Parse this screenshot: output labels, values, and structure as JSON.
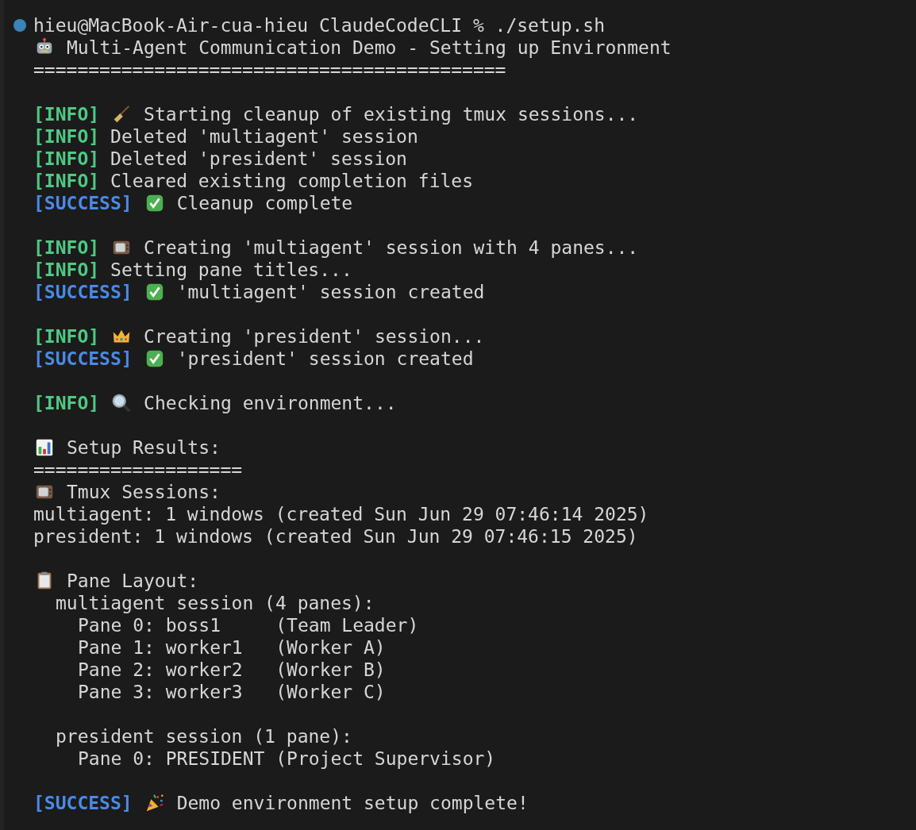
{
  "terminal": {
    "lines": [
      {
        "kind": "prompt",
        "text": "hieu@MacBook-Air-cua-hieu ClaudeCodeCLI % ./setup.sh"
      },
      {
        "kind": "heading",
        "text": "Multi-Agent Communication Demo - Setting up Environment"
      },
      {
        "kind": "text",
        "text": "==========================================="
      },
      {
        "kind": "blank"
      },
      {
        "kind": "info",
        "tag": "[INFO]",
        "text": "Starting cleanup of existing tmux sessions..."
      },
      {
        "kind": "info",
        "tag": "[INFO]",
        "text": "Deleted 'multiagent' session"
      },
      {
        "kind": "info",
        "tag": "[INFO]",
        "text": "Deleted 'president' session"
      },
      {
        "kind": "info",
        "tag": "[INFO]",
        "text": "Cleared existing completion files"
      },
      {
        "kind": "success",
        "tag": "[SUCCESS]",
        "text": "Cleanup complete"
      },
      {
        "kind": "blank"
      },
      {
        "kind": "info",
        "tag": "[INFO]",
        "text": "Creating 'multiagent' session with 4 panes..."
      },
      {
        "kind": "info",
        "tag": "[INFO]",
        "text": "Setting pane titles..."
      },
      {
        "kind": "success",
        "tag": "[SUCCESS]",
        "text": "'multiagent' session created"
      },
      {
        "kind": "blank"
      },
      {
        "kind": "info",
        "tag": "[INFO]",
        "text": "Creating 'president' session..."
      },
      {
        "kind": "success",
        "tag": "[SUCCESS]",
        "text": "'president' session created"
      },
      {
        "kind": "blank"
      },
      {
        "kind": "info",
        "tag": "[INFO]",
        "text": "Checking environment..."
      },
      {
        "kind": "blank"
      },
      {
        "kind": "heading",
        "text": "Setup Results:"
      },
      {
        "kind": "text",
        "text": "==================="
      },
      {
        "kind": "heading",
        "text": "Tmux Sessions:"
      },
      {
        "kind": "text",
        "text": "multiagent: 1 windows (created Sun Jun 29 07:46:14 2025)"
      },
      {
        "kind": "text",
        "text": "president: 1 windows (created Sun Jun 29 07:46:15 2025)"
      },
      {
        "kind": "blank"
      },
      {
        "kind": "heading",
        "text": "Pane Layout:",
        "children": [
          {
            "kind": "text",
            "text": "multiagent session (4 panes):",
            "children": [
              {
                "kind": "text",
                "text": "Pane 0: boss1     (Team Leader)"
              },
              {
                "kind": "text",
                "text": "Pane 1: worker1   (Worker A)"
              },
              {
                "kind": "text",
                "text": "Pane 2: worker2   (Worker B)"
              },
              {
                "kind": "text",
                "text": "Pane 3: worker3   (Worker C)"
              }
            ]
          },
          {
            "kind": "blank"
          },
          {
            "kind": "text",
            "text": "president session (1 pane):",
            "children": [
              {
                "kind": "text",
                "text": "Pane 0: PRESIDENT (Project Supervisor)"
              }
            ]
          }
        ]
      },
      {
        "kind": "blank"
      },
      {
        "kind": "success",
        "tag": "[SUCCESS]",
        "text": "Demo environment setup complete!"
      }
    ]
  }
}
